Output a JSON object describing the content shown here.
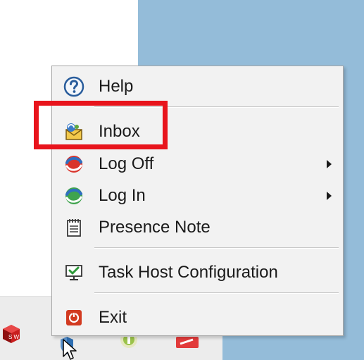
{
  "menu": {
    "items": [
      {
        "label": "Help",
        "icon": "help-icon"
      },
      {
        "label": "Inbox",
        "icon": "inbox-icon"
      },
      {
        "label": "Log Off",
        "icon": "log-off-icon",
        "has_submenu": true
      },
      {
        "label": "Log In",
        "icon": "log-in-icon",
        "has_submenu": true
      },
      {
        "label": "Presence Note",
        "icon": "notepad-icon"
      },
      {
        "label": "Task Host Configuration",
        "icon": "monitor-check-icon"
      },
      {
        "label": "Exit",
        "icon": "power-icon"
      }
    ]
  },
  "highlight": {
    "target": "Inbox",
    "color": "#e8141c"
  },
  "colors": {
    "menu_background": "#f2f2f2",
    "desktop_background": "#94bcd9"
  }
}
